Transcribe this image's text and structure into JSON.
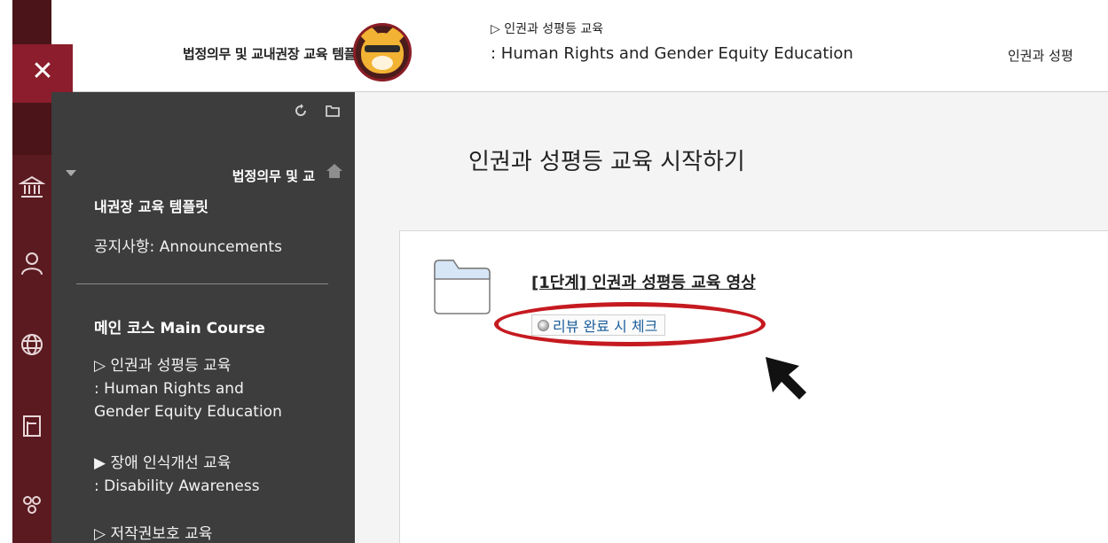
{
  "header": {
    "course_title": "법정의무 및 교내권장 교육 템플릿",
    "breadcrumb_line1": "▷ 인권과 성평등 교육",
    "breadcrumb_line2": ": Human Rights and Gender Equity Education",
    "breadcrumb_right": "인권과 성평"
  },
  "close_button": {
    "label": "✕"
  },
  "rail": {
    "icons": [
      "institution-icon",
      "user-icon",
      "globe-icon",
      "courses-icon",
      "groups-icon"
    ]
  },
  "menu": {
    "course_line1": "법정의무 및 교",
    "course_line2": "내권장 교육 템플릿",
    "announcements": "공지사항: Announcements",
    "section_title": "메인 코스 Main Course",
    "items": [
      {
        "line1": "▷ 인권과 성평등 교육",
        "line2": ": Human Rights and",
        "line3": "Gender Equity Education"
      },
      {
        "line1": "▶ 장애 인식개선 교육",
        "line2": ": Disability Awareness"
      },
      {
        "line1": "▷ 저작권보호 교육"
      }
    ]
  },
  "content": {
    "page_title": "인권과 성평등 교육 시작하기",
    "item_title": "[1단계] 인권과 성평등 교육 영상",
    "review_button_label": "리뷰 완료 시 체크"
  },
  "colors": {
    "brand_dark": "#5a1a1f",
    "accent": "#8b1d2c",
    "menu_bg": "#3d3d3d",
    "highlight": "#c51a20",
    "link": "#1a5d9a"
  }
}
